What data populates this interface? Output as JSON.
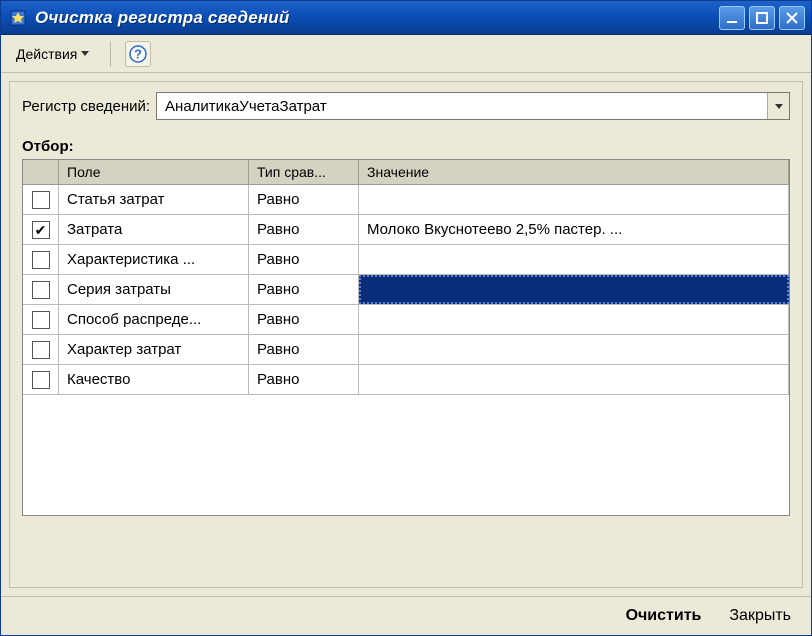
{
  "window": {
    "title": "Очистка регистра сведений"
  },
  "toolbar": {
    "actions_label": "Действия"
  },
  "register": {
    "label": "Регистр сведений:",
    "value": "АналитикаУчетаЗатрат"
  },
  "filter": {
    "section_label": "Отбор:",
    "headers": {
      "check": "",
      "field": "Поле",
      "comparison": "Тип срав...",
      "value": "Значение"
    },
    "rows": [
      {
        "checked": false,
        "field": "Статья затрат",
        "comparison": "Равно",
        "value": "",
        "selected": false
      },
      {
        "checked": true,
        "field": "Затрата",
        "comparison": "Равно",
        "value": "Молоко   Вкуснотеево 2,5% пастер.   ...",
        "selected": false
      },
      {
        "checked": false,
        "field": "Характеристика ...",
        "comparison": "Равно",
        "value": "",
        "selected": false
      },
      {
        "checked": false,
        "field": "Серия затраты",
        "comparison": "Равно",
        "value": "",
        "selected": true
      },
      {
        "checked": false,
        "field": "Способ распреде...",
        "comparison": "Равно",
        "value": "",
        "selected": false
      },
      {
        "checked": false,
        "field": "Характер затрат",
        "comparison": "Равно",
        "value": "",
        "selected": false
      },
      {
        "checked": false,
        "field": "Качество",
        "comparison": "Равно",
        "value": "",
        "selected": false
      }
    ]
  },
  "buttons": {
    "clear": "Очистить",
    "close": "Закрыть"
  }
}
